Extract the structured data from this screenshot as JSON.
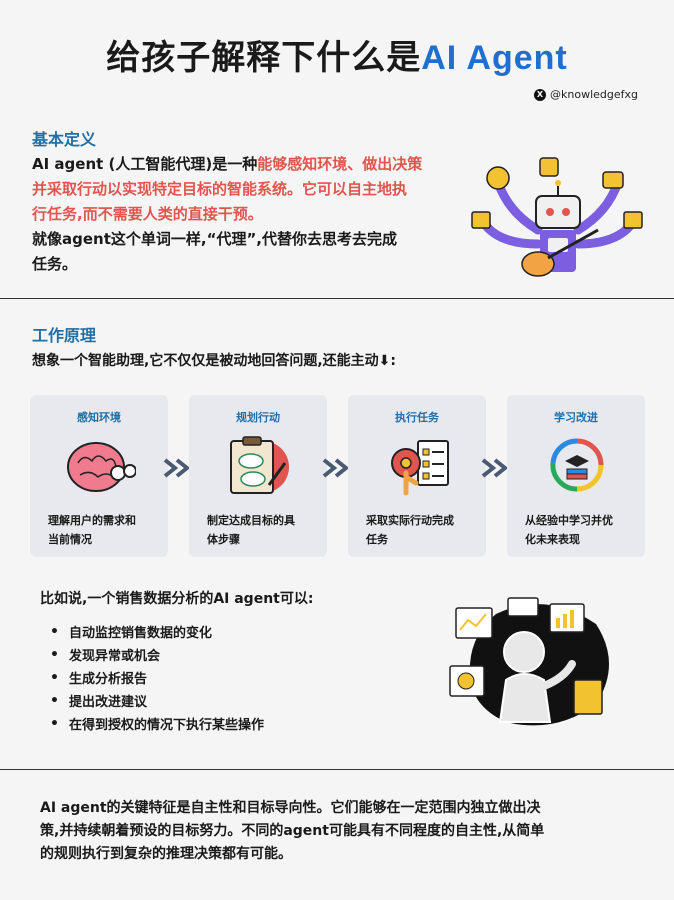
{
  "header": {
    "title_prefix": "给孩子解释下什么是",
    "title_accent": "AI Agent",
    "handle": "@knowledgefxg"
  },
  "definition": {
    "heading": "基本定义",
    "p1_part1": "AI agent (人工智能代理)是一种",
    "p1_highlight_line1": "能够感知环境、做出决策",
    "p1_highlight_line2": "并采取行动以实现特定目标的智能系统。它可以自主地执",
    "p1_highlight_line3": "行任务,而不需要人类的直接干预。",
    "p2_line1": "就像agent这个单词一样,“代理”,代替你去思考去完成",
    "p2_line2": "任务。"
  },
  "principle": {
    "heading": "工作原理",
    "intro": "想象一个智能助理,它不仅仅是被动地回答问题,还能主动⬇:",
    "steps": [
      {
        "title": "感知环境",
        "desc_line1": "理解用户的需求和",
        "desc_line2": "当前情况",
        "icon": "brain-icon"
      },
      {
        "title": "规划行动",
        "desc_line1": "制定达成目标的具",
        "desc_line2": "体步骤",
        "icon": "clipboard-plan-icon"
      },
      {
        "title": "执行任务",
        "desc_line1": "采取实际行动完成",
        "desc_line2": "任务",
        "icon": "gear-checklist-icon"
      },
      {
        "title": "学习改进",
        "desc_line1": "从经验中学习并优",
        "desc_line2": "化未来表现",
        "icon": "learning-cycle-icon"
      }
    ]
  },
  "example": {
    "title": "比如说,一个销售数据分析的AI agent可以:",
    "items": [
      "自动监控销售数据的变化",
      "发现异常或机会",
      "生成分析报告",
      "提出改进建议",
      "在得到授权的情况下执行某些操作"
    ]
  },
  "closing": {
    "line1": "AI agent的关键特征是自主性和目标导向性。它们能够在一定范围内独立做出决",
    "line2": "策,并持续朝着预设的目标努力。不同的agent可能具有不同程度的自主性,从简单",
    "line3": "的规则执行到复杂的推理决策都有可能。"
  },
  "colors": {
    "accent": "#1f6fd1",
    "heading": "#1f6fa8",
    "highlight": "#e0564e",
    "card": "#e7e9ee"
  }
}
